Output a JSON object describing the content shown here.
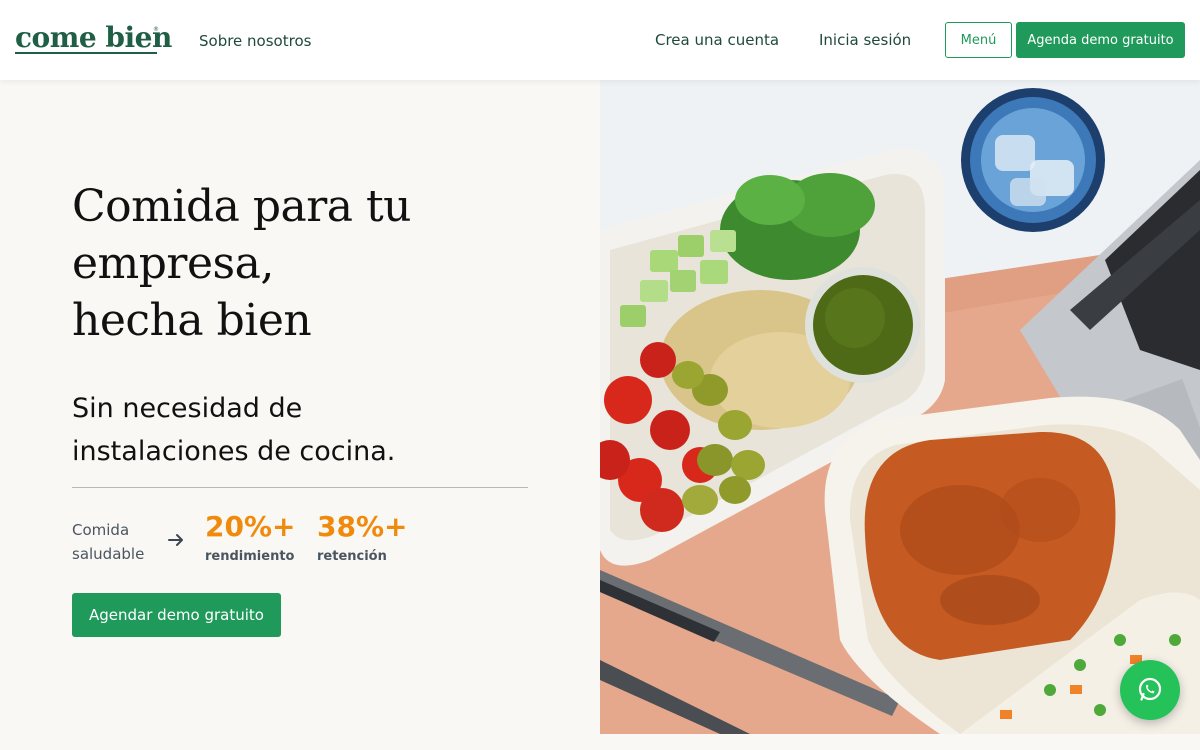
{
  "header": {
    "logo": "come bien",
    "logo_mark": "®",
    "nav_about": "Sobre nosotros",
    "nav_create_account": "Crea una cuenta",
    "nav_login": "Inicia sesión",
    "menu_button": "Menú",
    "demo_button": "Agenda demo gratuito"
  },
  "hero": {
    "title_lines": [
      "Comida para tu",
      "empresa,",
      "hecha bien"
    ],
    "subtitle_lines": [
      "Sin necesidad de",
      "instalaciones de cocina."
    ],
    "stat_label_lines": [
      "Comida",
      "saludable"
    ],
    "stats": [
      {
        "value": "20%+",
        "caption": "rendimiento"
      },
      {
        "value": "38%+",
        "caption": "retención"
      }
    ],
    "cta_button": "Agendar demo gratuito"
  },
  "icons": {
    "stat_arrow": "arrow-right-icon",
    "chat": "whatsapp-icon"
  },
  "colors": {
    "brand_green": "#1f9a5a",
    "logo_green": "#1f5f45",
    "accent_orange": "#f08a0c",
    "whatsapp_green": "#25c25a",
    "background": "#faf8f4"
  }
}
